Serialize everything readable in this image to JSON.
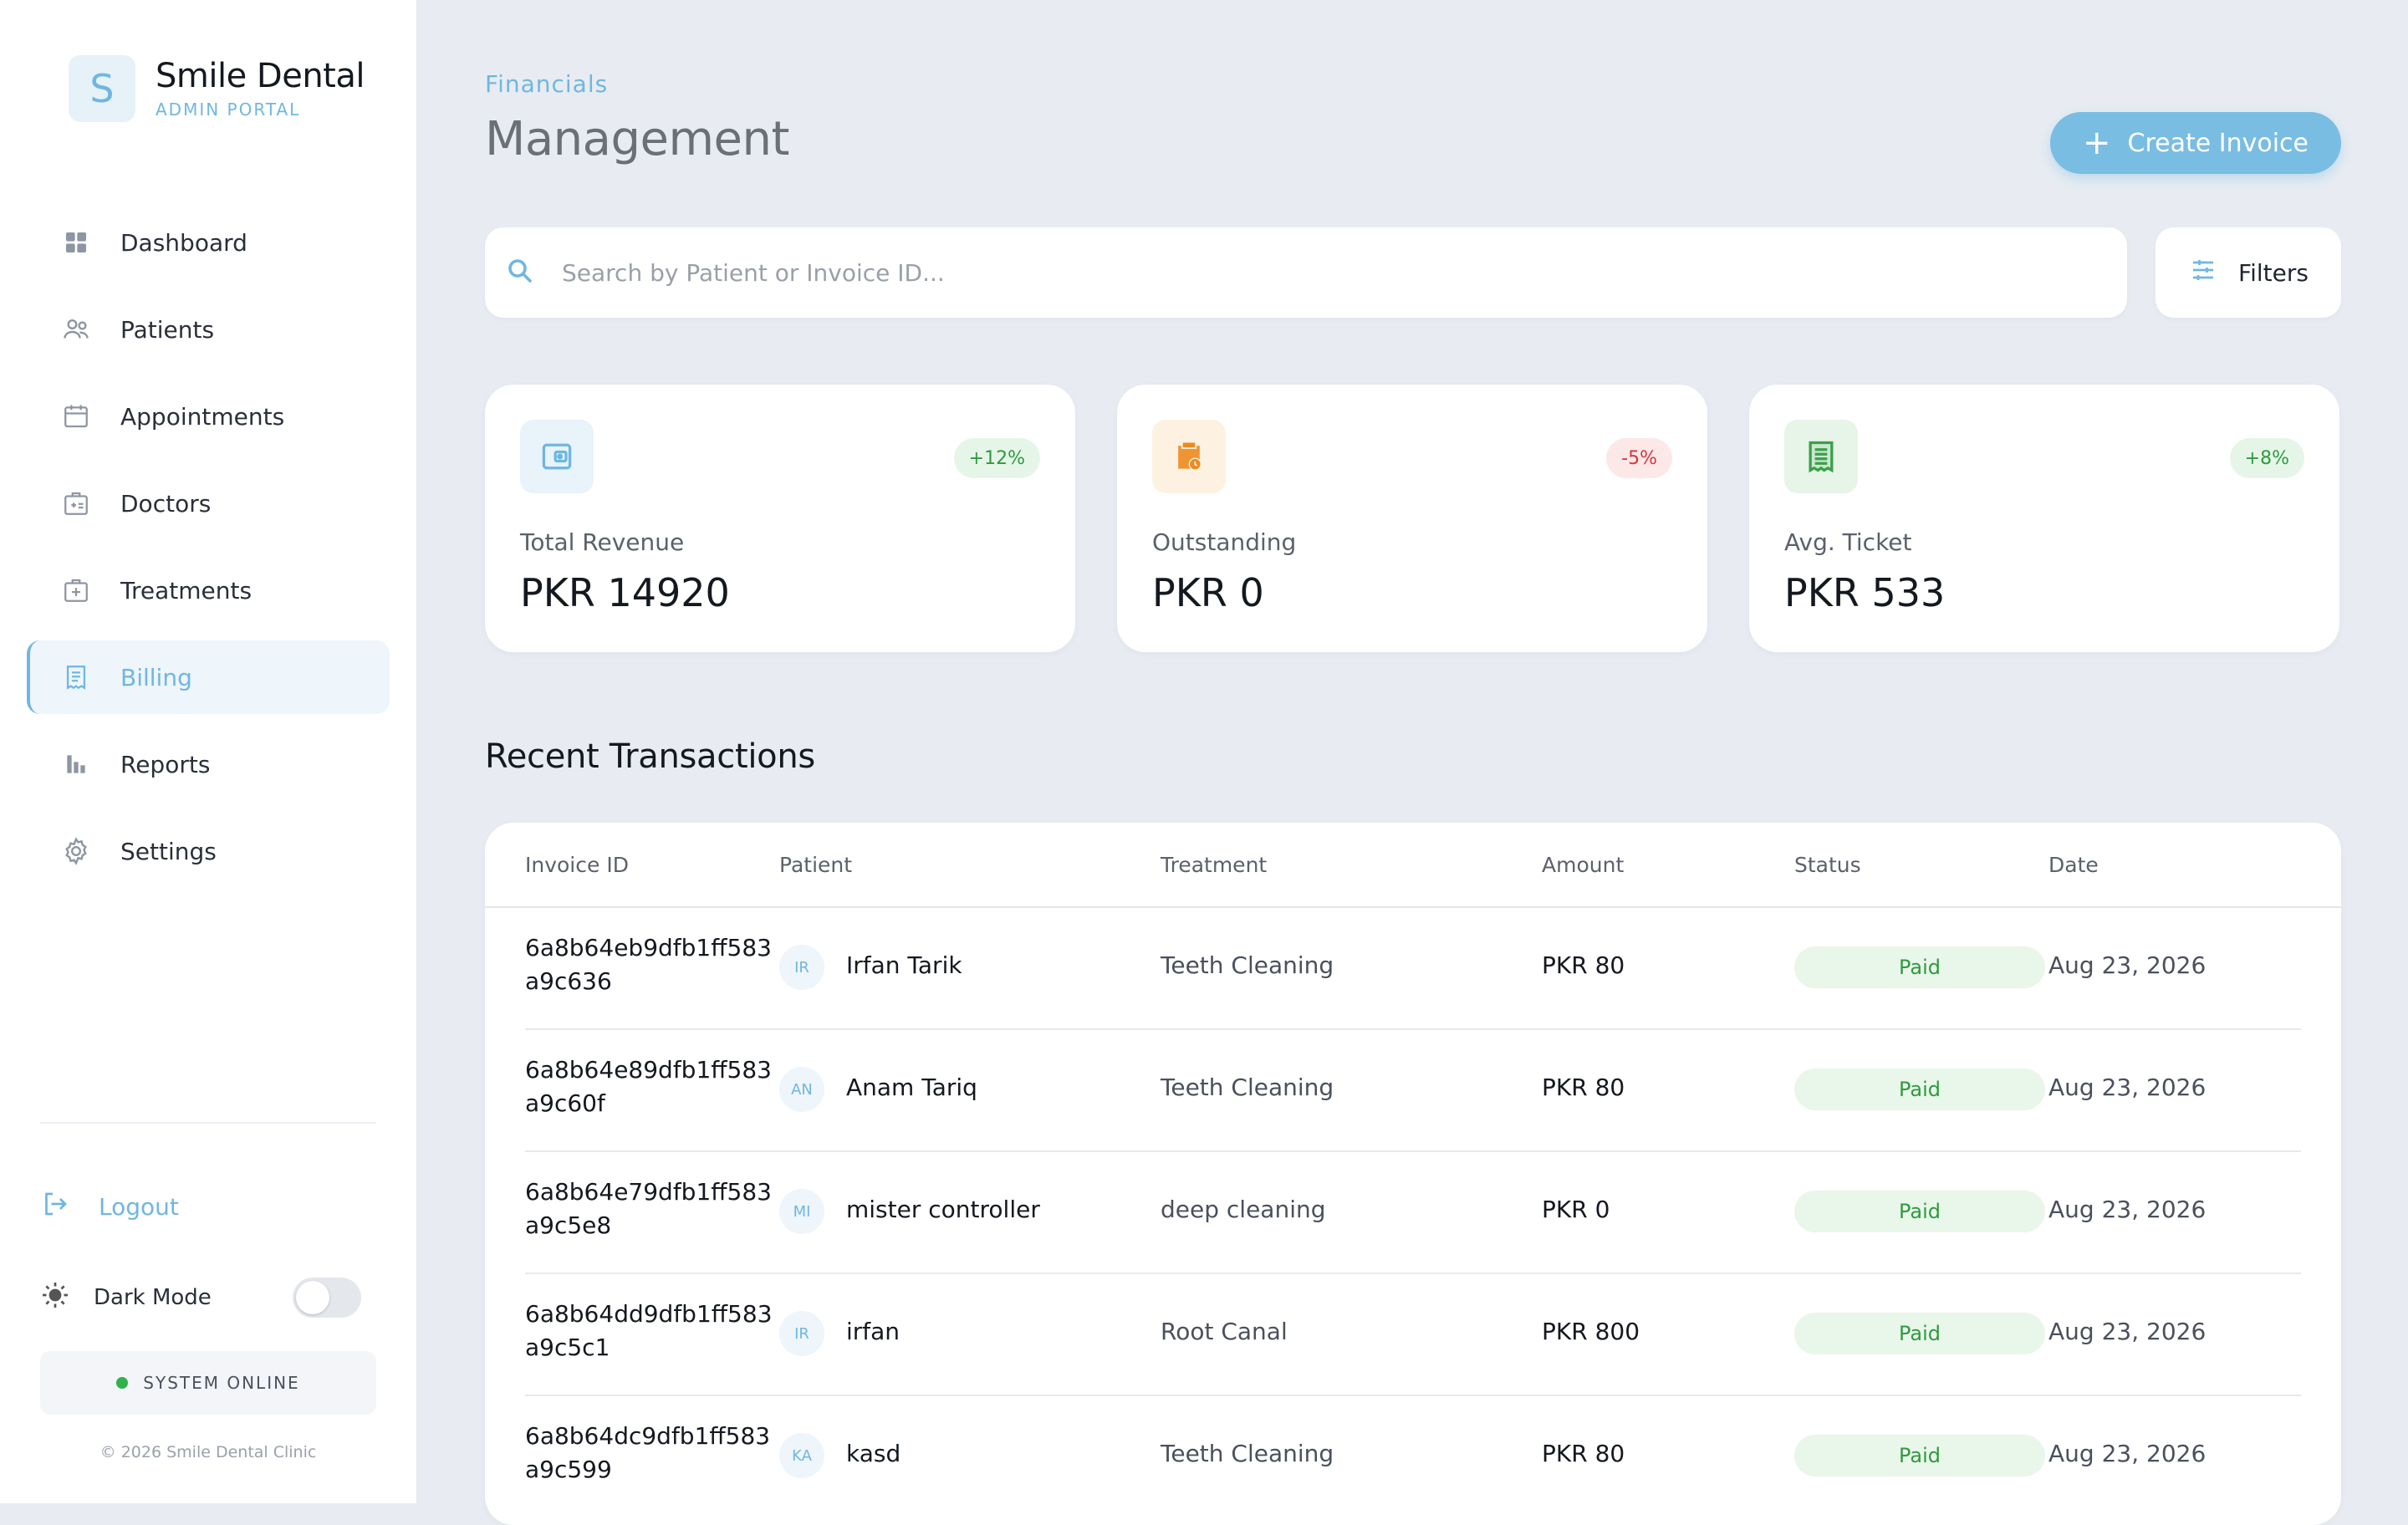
{
  "brand": {
    "logo_letter": "S",
    "name": "Smile Dental",
    "subtitle": "ADMIN PORTAL"
  },
  "sidebar": {
    "items": [
      {
        "label": "Dashboard",
        "icon": "grid-icon",
        "active": false
      },
      {
        "label": "Patients",
        "icon": "users-icon",
        "active": false
      },
      {
        "label": "Appointments",
        "icon": "calendar-icon",
        "active": false
      },
      {
        "label": "Doctors",
        "icon": "doctor-badge-icon",
        "active": false
      },
      {
        "label": "Treatments",
        "icon": "medical-kit-icon",
        "active": false
      },
      {
        "label": "Billing",
        "icon": "receipt-icon",
        "active": true
      },
      {
        "label": "Reports",
        "icon": "bar-chart-icon",
        "active": false
      },
      {
        "label": "Settings",
        "icon": "gear-icon",
        "active": false
      }
    ],
    "logout_label": "Logout",
    "dark_mode_label": "Dark Mode",
    "dark_mode_on": false,
    "system_status": "SYSTEM ONLINE",
    "copyright": "© 2026 Smile Dental Clinic"
  },
  "header": {
    "breadcrumb": "Financials",
    "title": "Management",
    "create_label": "Create Invoice"
  },
  "search": {
    "placeholder": "Search by Patient or Invoice ID...",
    "value": ""
  },
  "filters_label": "Filters",
  "stats": [
    {
      "label": "Total Revenue",
      "value": "PKR 14920",
      "change": "+12%",
      "trend": "up",
      "icon": "wallet-icon"
    },
    {
      "label": "Outstanding",
      "value": "PKR 0",
      "change": "-5%",
      "trend": "down",
      "icon": "clipboard-clock-icon"
    },
    {
      "label": "Avg. Ticket",
      "value": "PKR 533",
      "change": "+8%",
      "trend": "up",
      "icon": "receipt-list-icon"
    }
  ],
  "transactions": {
    "title": "Recent Transactions",
    "columns": [
      "Invoice ID",
      "Patient",
      "Treatment",
      "Amount",
      "Status",
      "Date"
    ],
    "rows": [
      {
        "invoice": "6a8b64eb9dfb1ff583a9c636",
        "initials": "IR",
        "patient": "Irfan Tarik",
        "treatment": "Teeth Cleaning",
        "amount": "PKR 80",
        "status": "Paid",
        "date": "Aug 23, 2026"
      },
      {
        "invoice": "6a8b64e89dfb1ff583a9c60f",
        "initials": "AN",
        "patient": "Anam Tariq",
        "treatment": "Teeth Cleaning",
        "amount": "PKR 80",
        "status": "Paid",
        "date": "Aug 23, 2026"
      },
      {
        "invoice": "6a8b64e79dfb1ff583a9c5e8",
        "initials": "MI",
        "patient": "mister controller",
        "treatment": "deep cleaning",
        "amount": "PKR 0",
        "status": "Paid",
        "date": "Aug 23, 2026"
      },
      {
        "invoice": "6a8b64dd9dfb1ff583a9c5c1",
        "initials": "IR",
        "patient": "irfan",
        "treatment": "Root Canal",
        "amount": "PKR 800",
        "status": "Paid",
        "date": "Aug 23, 2026"
      },
      {
        "invoice": "6a8b64dc9dfb1ff583a9c599",
        "initials": "KA",
        "patient": "kasd",
        "treatment": "Teeth Cleaning",
        "amount": "PKR 80",
        "status": "Paid",
        "date": "Aug 23, 2026"
      }
    ]
  },
  "colors": {
    "accent": "#6fb7e0",
    "success": "#2f9a3f",
    "danger": "#d8333c",
    "background": "#e8ecf2"
  }
}
